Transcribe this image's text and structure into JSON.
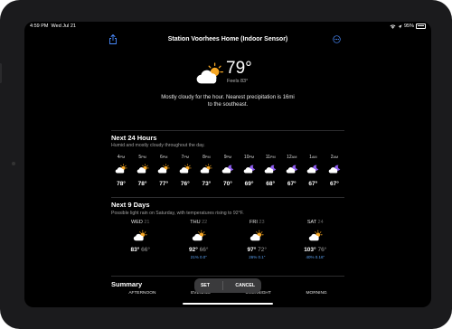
{
  "status_bar": {
    "time": "4:59 PM",
    "date": "Wed Jul 21",
    "battery": "95%"
  },
  "header": {
    "title": "Station Voorhees Home (Indoor Sensor)"
  },
  "current": {
    "temp": "79°",
    "feels": "Feels 83°",
    "condition_icon": "partly-cloudy-day-icon",
    "summary": "Mostly cloudy for the hour. Nearest precipitation is 16mi to the southeast."
  },
  "next24": {
    "title": "Next 24 Hours",
    "subtitle": "Humid and mostly cloudy throughout the day.",
    "hours": [
      {
        "time": "4",
        "ampm": "PM",
        "temp": "78°",
        "icon": "partly-cloudy-day-icon"
      },
      {
        "time": "5",
        "ampm": "PM",
        "temp": "78°",
        "icon": "partly-cloudy-day-icon"
      },
      {
        "time": "6",
        "ampm": "PM",
        "temp": "77°",
        "icon": "partly-cloudy-day-icon"
      },
      {
        "time": "7",
        "ampm": "PM",
        "temp": "76°",
        "icon": "partly-cloudy-day-icon"
      },
      {
        "time": "8",
        "ampm": "PM",
        "temp": "73°",
        "icon": "partly-cloudy-day-icon"
      },
      {
        "time": "9",
        "ampm": "PM",
        "temp": "70°",
        "icon": "partly-cloudy-night-icon"
      },
      {
        "time": "10",
        "ampm": "PM",
        "temp": "69°",
        "icon": "partly-cloudy-night-icon"
      },
      {
        "time": "11",
        "ampm": "PM",
        "temp": "68°",
        "icon": "partly-cloudy-night-icon"
      },
      {
        "time": "12",
        "ampm": "AM",
        "temp": "67°",
        "icon": "partly-cloudy-night-icon"
      },
      {
        "time": "1",
        "ampm": "AM",
        "temp": "67°",
        "icon": "partly-cloudy-night-icon"
      },
      {
        "time": "2",
        "ampm": "AM",
        "temp": "67°",
        "icon": "partly-cloudy-night-icon"
      }
    ]
  },
  "next9": {
    "title": "Next 9 Days",
    "subtitle": "Possible light rain on Saturday, with temperatures rising to 92°F.",
    "days": [
      {
        "day": "WED",
        "date": "21",
        "hi": "83°",
        "lo": "66°",
        "precip": "",
        "icon": "partly-cloudy-day-icon"
      },
      {
        "day": "THU",
        "date": "22",
        "hi": "92°",
        "lo": "66°",
        "precip": "21% 0.0\"",
        "icon": "partly-cloudy-day-icon"
      },
      {
        "day": "FRI",
        "date": "23",
        "hi": "97°",
        "lo": "72°",
        "precip": "26% 0.1\"",
        "icon": "partly-cloudy-day-icon"
      },
      {
        "day": "SAT",
        "date": "24",
        "hi": "103°",
        "lo": "76°",
        "precip": "40% 0.16\"",
        "icon": "partly-cloudy-day-icon"
      }
    ]
  },
  "summary_section": {
    "title": "Summary",
    "periods": [
      "AFTERNOON",
      "EVENING",
      "OVERNIGHT",
      "MORNING"
    ]
  },
  "actions": {
    "set": "SET",
    "cancel": "CANCEL"
  },
  "colors": {
    "background": "#000000",
    "sun": "#F5A623",
    "moon": "#8E5CF0",
    "precip": "#5AA0F0"
  }
}
